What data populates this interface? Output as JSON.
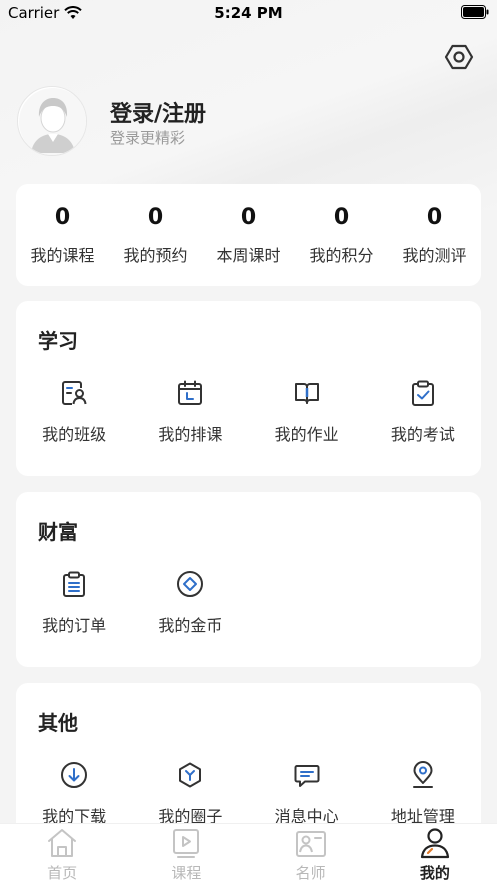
{
  "status_bar": {
    "carrier": "Carrier",
    "time": "5:24 PM"
  },
  "profile": {
    "title": "登录/注册",
    "subtitle": "登录更精彩"
  },
  "stats": [
    {
      "value": "0",
      "label": "我的课程"
    },
    {
      "value": "0",
      "label": "我的预约"
    },
    {
      "value": "0",
      "label": "本周课时"
    },
    {
      "value": "0",
      "label": "我的积分"
    },
    {
      "value": "0",
      "label": "我的测评"
    }
  ],
  "study": {
    "title": "学习",
    "items": [
      {
        "label": "我的班级",
        "icon": "class-icon"
      },
      {
        "label": "我的排课",
        "icon": "calendar-icon"
      },
      {
        "label": "我的作业",
        "icon": "book-icon"
      },
      {
        "label": "我的考试",
        "icon": "exam-clipboard-icon"
      }
    ]
  },
  "wealth": {
    "title": "财富",
    "items": [
      {
        "label": "我的订单",
        "icon": "order-icon"
      },
      {
        "label": "我的金币",
        "icon": "coin-icon"
      }
    ]
  },
  "other": {
    "title": "其他",
    "items": [
      {
        "label": "我的下载",
        "icon": "download-icon"
      },
      {
        "label": "我的圈子",
        "icon": "circle-icon"
      },
      {
        "label": "消息中心",
        "icon": "message-icon"
      },
      {
        "label": "地址管理",
        "icon": "location-icon"
      }
    ]
  },
  "tabbar": {
    "items": [
      {
        "label": "首页",
        "icon": "home-icon"
      },
      {
        "label": "课程",
        "icon": "course-icon"
      },
      {
        "label": "名师",
        "icon": "teacher-icon"
      },
      {
        "label": "我的",
        "icon": "profile-icon"
      }
    ],
    "active_index": 3
  },
  "colors": {
    "accent_blue": "#2f6fc9",
    "icon_dark": "#333333",
    "muted": "#b8b8b8"
  }
}
